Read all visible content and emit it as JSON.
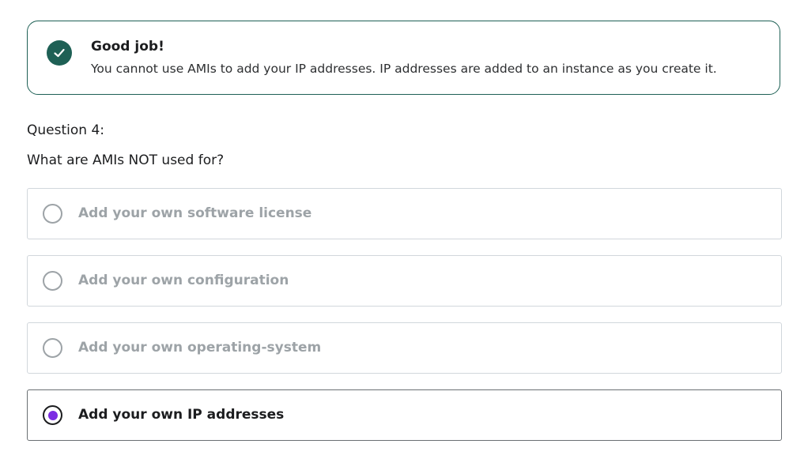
{
  "feedback": {
    "status_icon": "checkmark-icon",
    "title": "Good job!",
    "message": "You cannot use AMIs to add your IP addresses. IP addresses are added to an instance as you create it.",
    "accent_color": "#1e6055"
  },
  "question": {
    "number_label": "Question 4:",
    "prompt": "What are AMIs NOT used for?"
  },
  "options": [
    {
      "label": "Add your own software license",
      "selected": false
    },
    {
      "label": "Add your own configuration",
      "selected": false
    },
    {
      "label": "Add your own operating-system",
      "selected": false
    },
    {
      "label": "Add your own IP addresses",
      "selected": true
    }
  ],
  "selected_color": "#7b2ce3"
}
